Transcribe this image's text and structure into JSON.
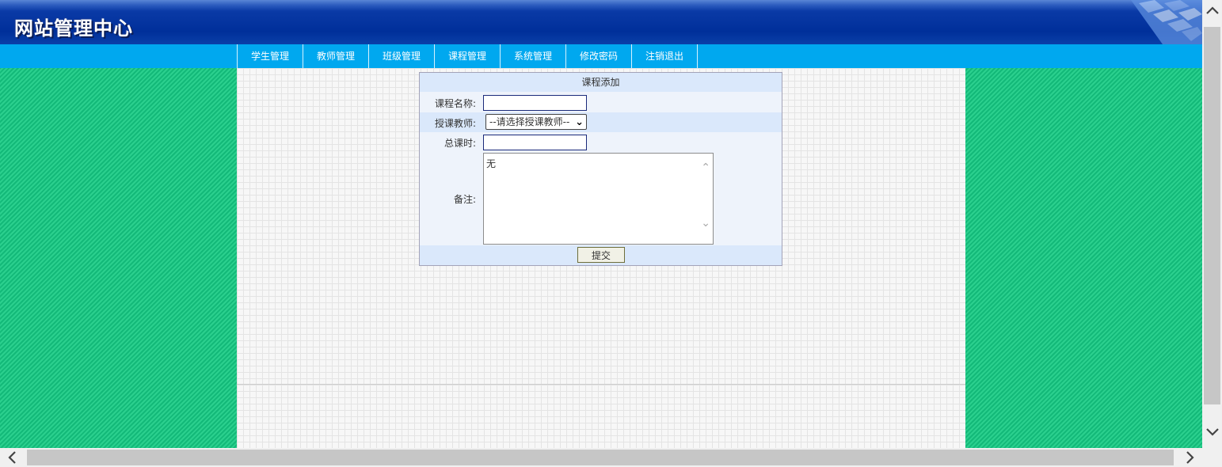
{
  "header": {
    "site_title": "网站管理中心"
  },
  "nav": {
    "items": [
      {
        "label": "学生管理"
      },
      {
        "label": "教师管理"
      },
      {
        "label": "班级管理"
      },
      {
        "label": "课程管理"
      },
      {
        "label": "系统管理"
      },
      {
        "label": "修改密码"
      },
      {
        "label": "注销退出"
      }
    ]
  },
  "form": {
    "title": "课程添加",
    "course_name_label": "课程名称:",
    "course_name_value": "",
    "teacher_label": "授课教师:",
    "teacher_selected": "--请选择授课教师--",
    "hours_label": "总课时:",
    "hours_value": "",
    "remarks_label": "备注:",
    "remarks_value": "无",
    "submit_label": "提交"
  },
  "icons": {
    "scroll_up": "chevron-up-icon",
    "scroll_down": "chevron-down-icon",
    "scroll_left": "chevron-left-icon",
    "scroll_right": "chevron-right-icon"
  },
  "colors": {
    "header": "#002f9a",
    "navbar": "#00a8ef",
    "side_background": "#13b979",
    "form_header": "#dae8fb"
  }
}
